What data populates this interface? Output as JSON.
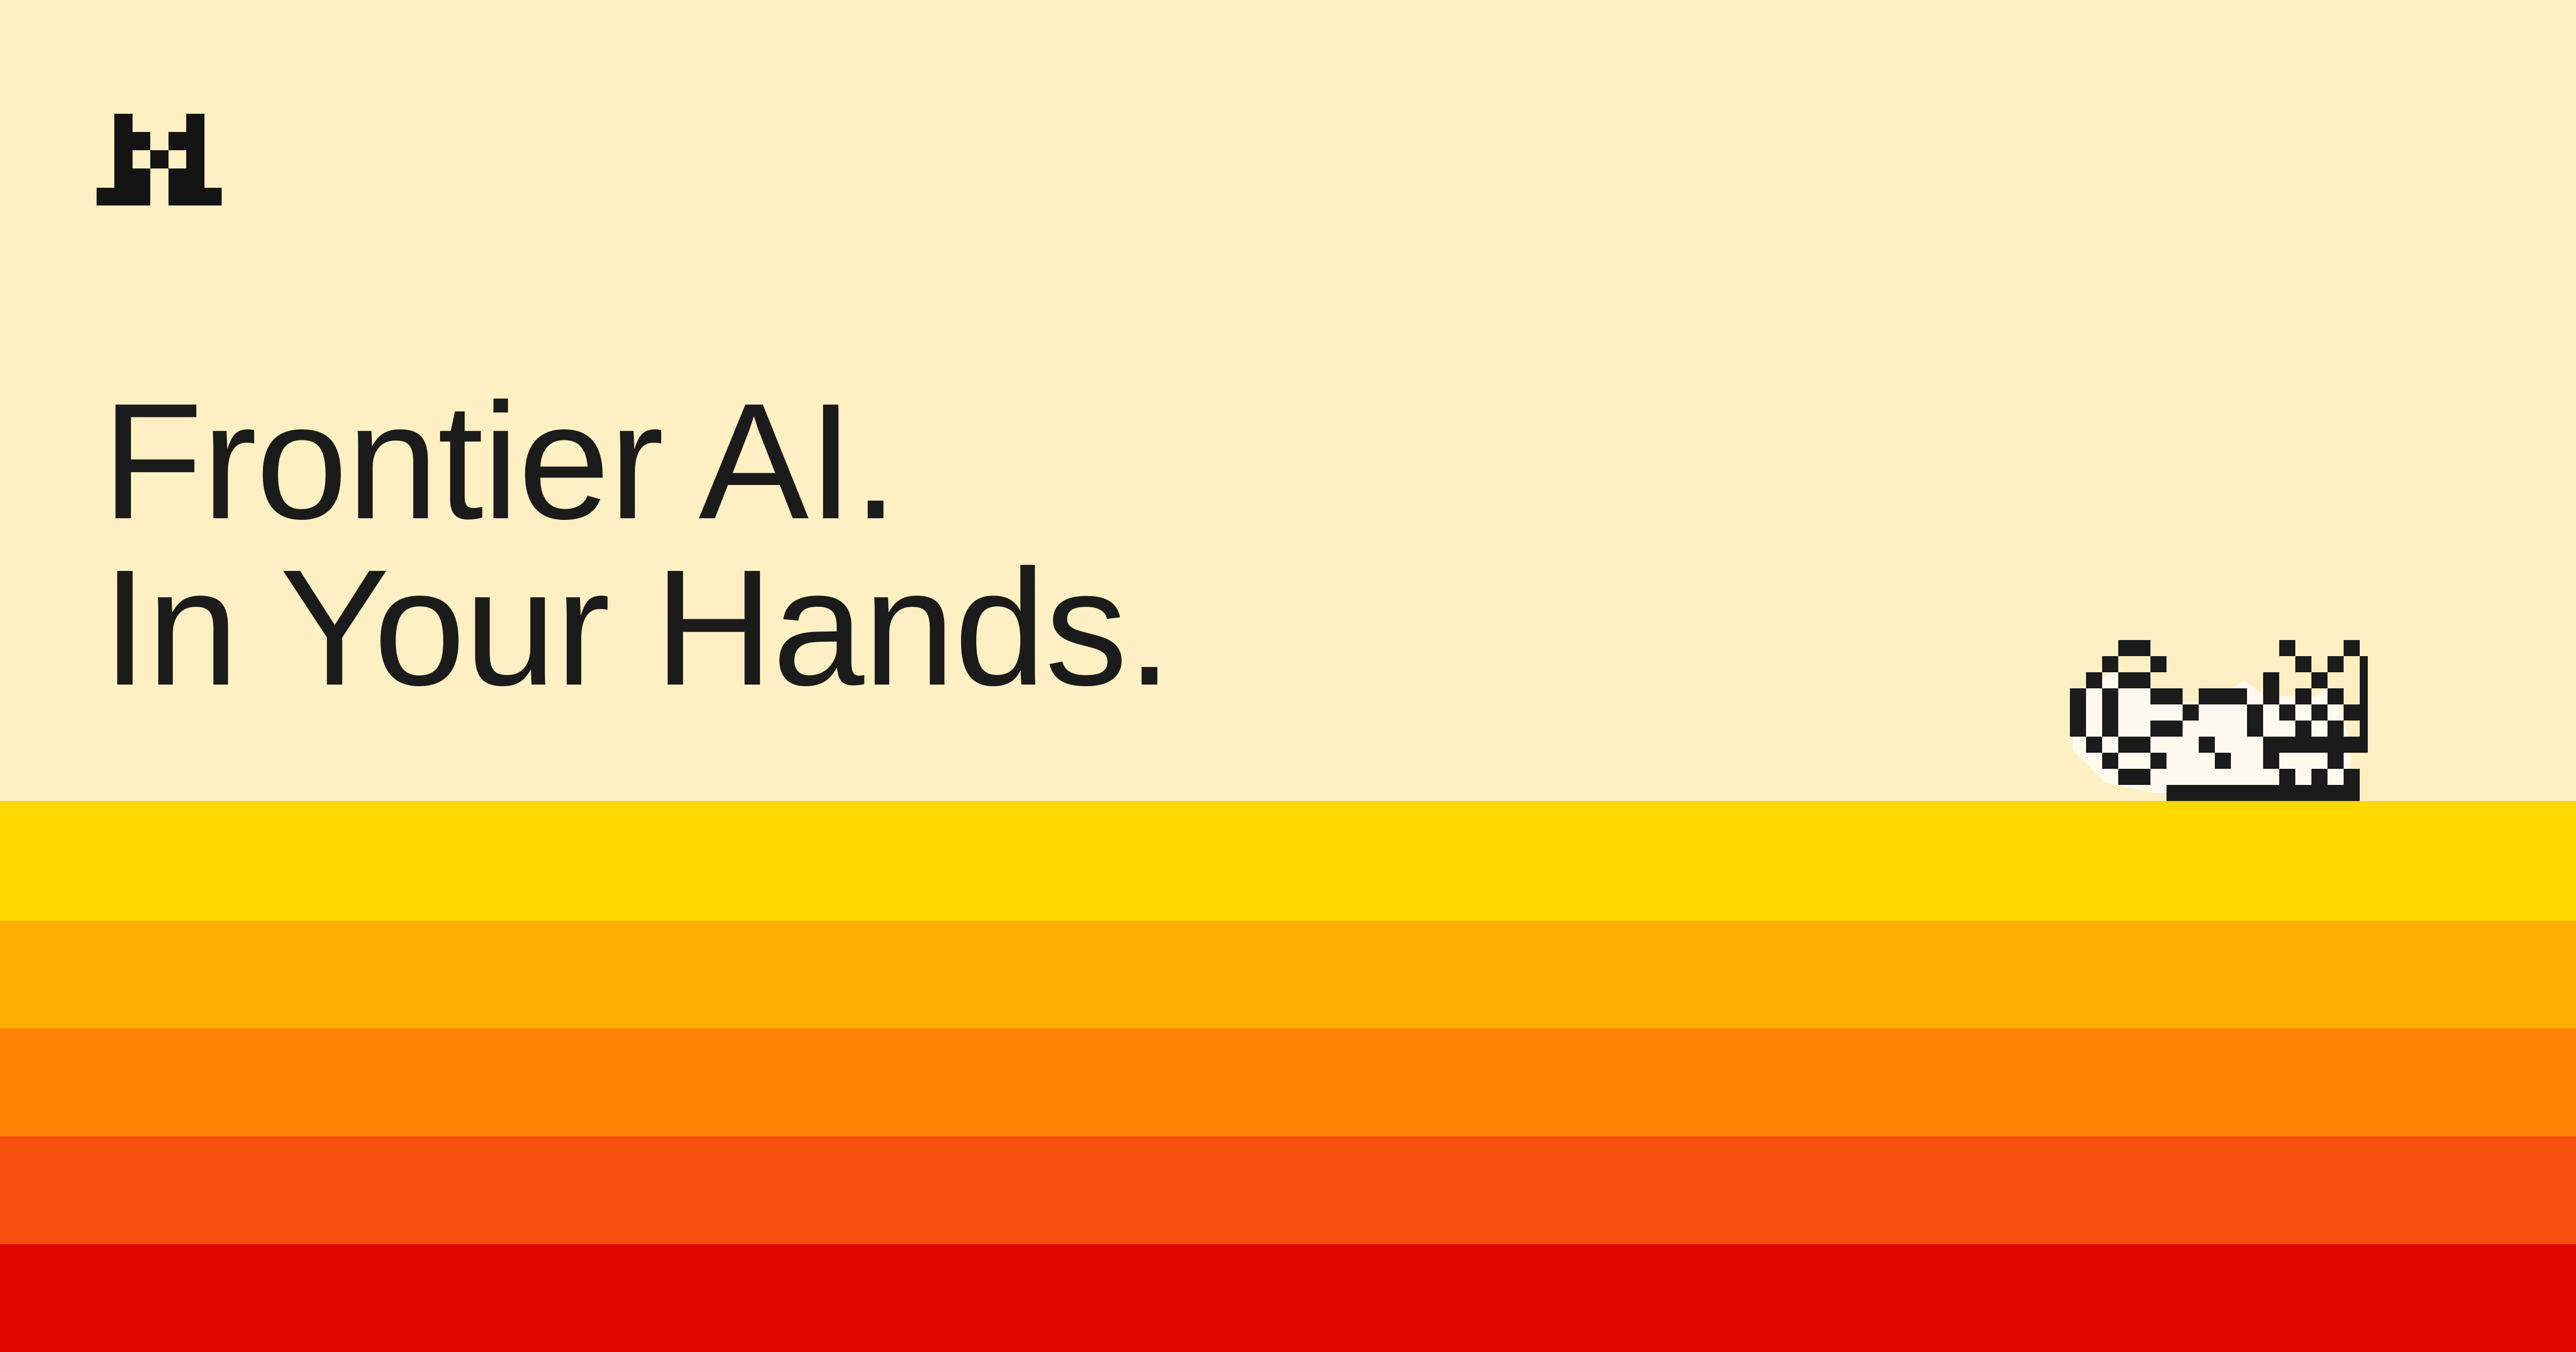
{
  "headline": {
    "line1": "Frontier AI.",
    "line2": "In Your Hands."
  },
  "logo": {
    "icon": "mistral-pixel-logo-icon",
    "color": "#141414"
  },
  "mascot": {
    "icon": "pixel-cat-icon",
    "outline_color": "#1b1b1b",
    "fill_color": "#fdfbf0"
  },
  "colors": {
    "background": "#fef0c2",
    "text": "#1b1b1b",
    "stripes": [
      "#ffd800",
      "#ffaf00",
      "#ff8205",
      "#fa500f",
      "#e10500"
    ]
  }
}
